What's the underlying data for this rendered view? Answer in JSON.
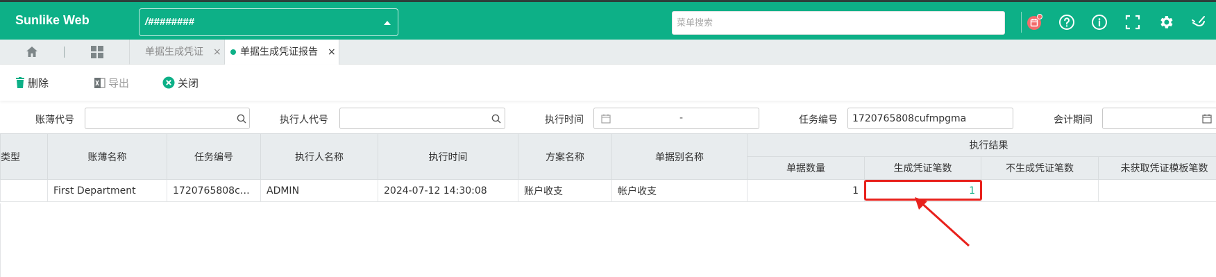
{
  "header": {
    "app_title": "Sunlike Web",
    "org_selector_value": "/########",
    "menu_search_placeholder": "菜单搜索",
    "brand_color": "#0db087",
    "icons": [
      "calendar-badge-icon",
      "help-icon",
      "info-icon",
      "fullscreen-icon",
      "settings-icon",
      "skin-icon"
    ]
  },
  "tabs": {
    "home_icon": "home-icon",
    "grid_icon": "grid-icon",
    "items": [
      {
        "label": "单据生成凭证",
        "active": false,
        "close": "×"
      },
      {
        "label": "单据生成凭证报告",
        "active": true,
        "close": "×"
      }
    ]
  },
  "toolbar": {
    "delete_label": "删除",
    "export_label": "导出",
    "close_label": "关闭"
  },
  "filters": {
    "ledger_code_label": "账薄代号",
    "ledger_code_value": "",
    "executor_code_label": "执行人代号",
    "executor_code_value": "",
    "exec_time_label": "执行时间",
    "exec_time_separator": "-",
    "task_no_label": "任务编号",
    "task_no_value": "1720765808cufmpgma",
    "period_label": "会计期间",
    "period_value": ""
  },
  "table": {
    "columns": [
      "类型",
      "账薄名称",
      "任务编号",
      "执行人名称",
      "执行时间",
      "方案名称",
      "单据别名称"
    ],
    "result_group": "执行结果",
    "result_columns": [
      "单据数量",
      "生成凭证笔数",
      "不生成凭证笔数",
      "未获取凭证模板笔数"
    ],
    "rows": [
      {
        "type": "",
        "ledger_name": "First Department",
        "task_no": "1720765808cuf...",
        "executor_name": "ADMIN",
        "exec_time": "2024-07-12 14:30:08",
        "scheme_name": "账户收支",
        "doc_alias": "帐户收支",
        "doc_count": "1",
        "voucher_count": "1",
        "no_voucher_count": "",
        "no_template_count": ""
      }
    ]
  },
  "annotation": {
    "highlight_color": "#e8211c"
  }
}
